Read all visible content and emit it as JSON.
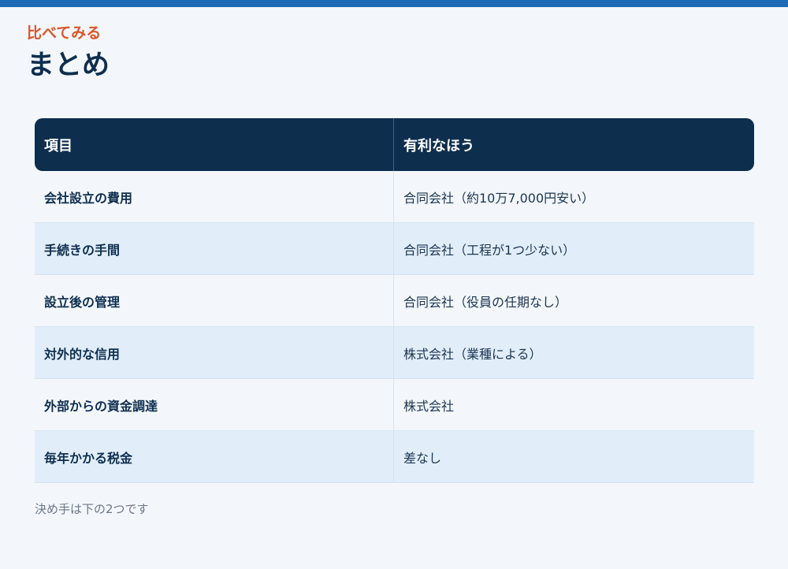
{
  "header": {
    "eyebrow": "比べてみる",
    "title": "まとめ"
  },
  "table": {
    "columns": [
      "項目",
      "有利なほう"
    ],
    "rows": [
      {
        "item": "会社設立の費用",
        "winner": "合同会社（約10万7,000円安い）"
      },
      {
        "item": "手続きの手間",
        "winner": "合同会社（工程が1つ少ない）"
      },
      {
        "item": "設立後の管理",
        "winner": "合同会社（役員の任期なし）"
      },
      {
        "item": "対外的な信用",
        "winner": "株式会社（業種による）"
      },
      {
        "item": "外部からの資金調達",
        "winner": "株式会社"
      },
      {
        "item": "毎年かかる税金",
        "winner": "差なし"
      }
    ]
  },
  "footnote": "決め手は下の2つです",
  "colors": {
    "accent_bar": "#1f6bb5",
    "eyebrow": "#d9562b",
    "header_bg": "#0e2e4e",
    "alt_row_bg": "#e1eefa"
  }
}
